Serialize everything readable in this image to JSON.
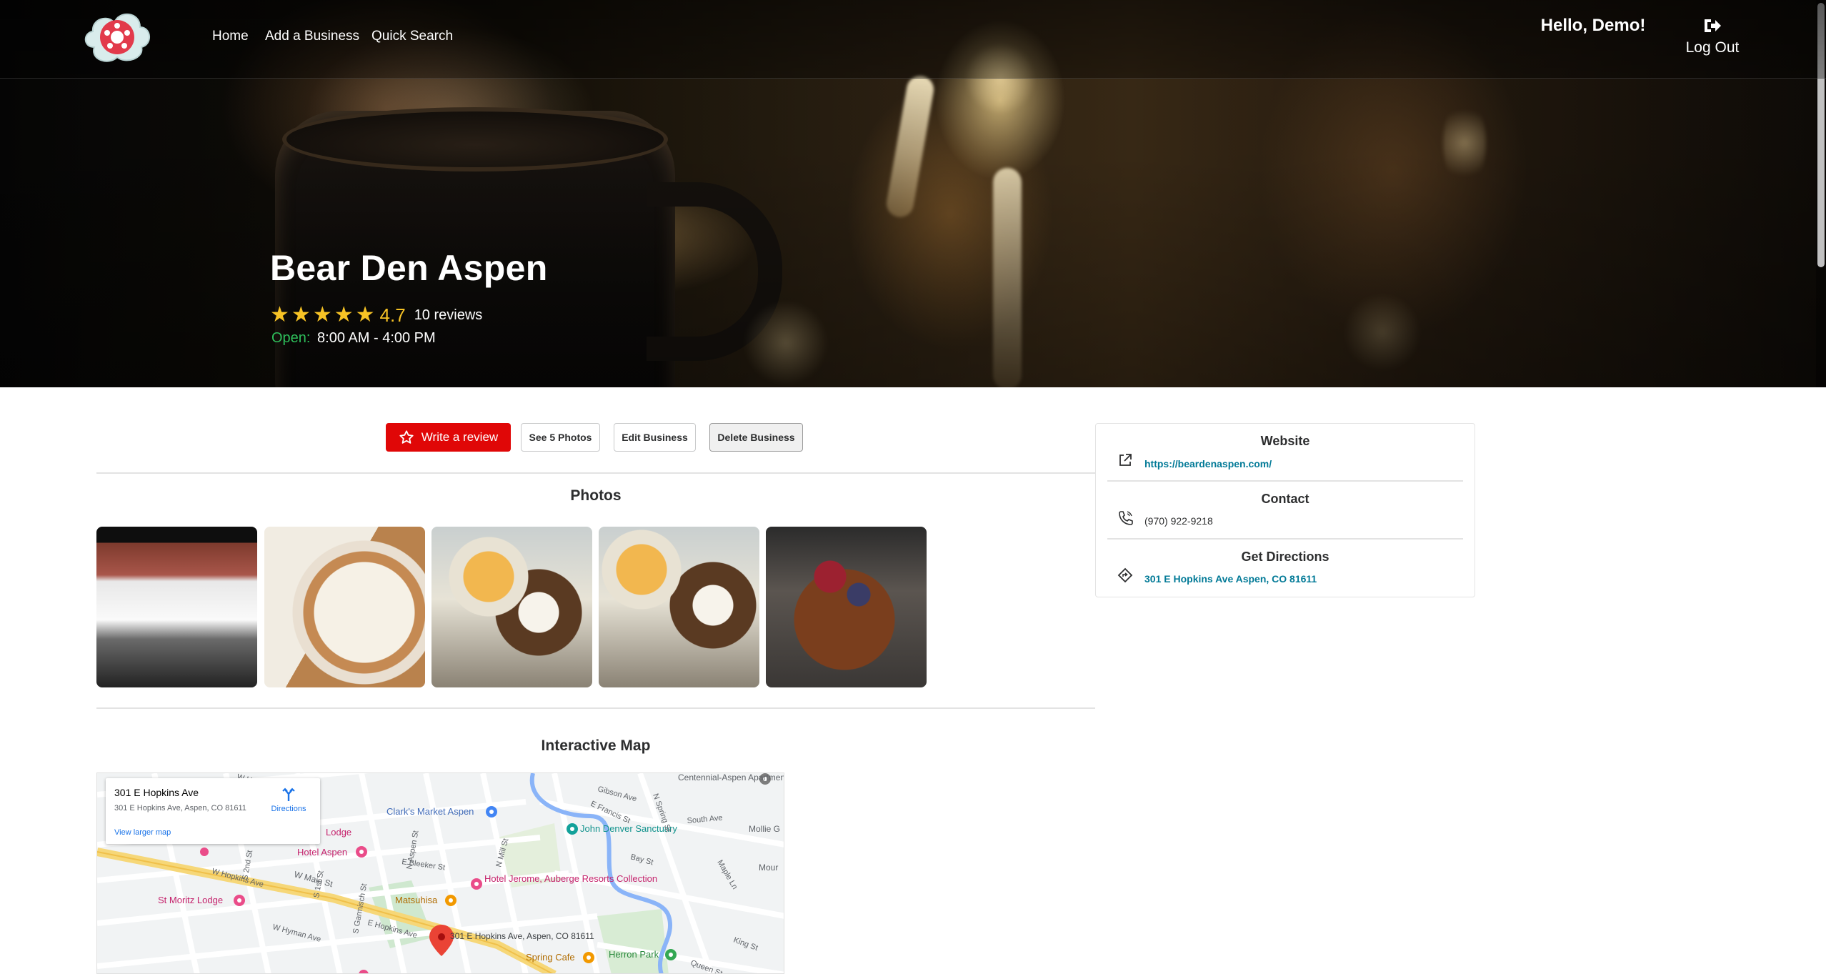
{
  "nav": {
    "links": [
      "Home",
      "Add a Business",
      "Quick Search"
    ],
    "greeting": "Hello, Demo!",
    "logout_label": "Log Out"
  },
  "business": {
    "name": "Bear Den Aspen",
    "rating": "4.7",
    "stars_filled": 5,
    "review_count": "10 reviews",
    "open_label": "Open:",
    "hours": "8:00 AM - 4:00 PM"
  },
  "actions": {
    "write_review": "Write a review",
    "see_photos": "See 5 Photos",
    "edit": "Edit Business",
    "delete": "Delete Business"
  },
  "photos": {
    "title": "Photos",
    "count": 5
  },
  "map": {
    "title": "Interactive Map",
    "card_title": "301 E Hopkins Ave",
    "card_address": "301 E Hopkins Ave, Aspen, CO 81611",
    "directions": "Directions",
    "larger_map": "View larger map",
    "pin_label": "301 E Hopkins Ave, Aspen, CO 81611",
    "labels": {
      "clarks": "Clark's Market Aspen",
      "john_denver": "John Denver Sanctuary",
      "hotel_aspen": "Hotel Aspen",
      "hotel_jerome": "Hotel Jerome, Auberge Resorts Collection",
      "st_moritz": "St Moritz Lodge",
      "matsuhisa": "Matsuhisa",
      "spring_cafe": "Spring Cafe",
      "herron_park": "Herron Park",
      "centennial": "Centennial-Aspen Apartments",
      "lodge": "Lodge",
      "mollie": "Mollie G",
      "mour": "Mour",
      "w_main": "W Main St",
      "w_hopkins": "W Hopkins Ave",
      "w_hyman": "W Hyman Ave",
      "e_hopkins": "E Hopkins Ave",
      "e_bleeker": "E Bleeker St",
      "n_mill": "N Mill St",
      "gibson": "Gibson Ave",
      "south_ave": "South Ave",
      "bay_st": "Bay St",
      "maple_ln": "Maple Ln",
      "king_st": "King St",
      "queen_st": "Queen St",
      "n_spring": "N Spring St",
      "n_aspen": "N Aspen St",
      "garmisch": "S Garmisch St",
      "first": "S 1st St",
      "second": "S 2nd St",
      "francis": "E Francis St",
      "w_hallam": "W Hallam"
    }
  },
  "sidebar": {
    "website_title": "Website",
    "website_url": "https://beardenaspen.com/",
    "contact_title": "Contact",
    "phone": "(970) 922-9218",
    "directions_title": "Get Directions",
    "address": "301 E Hopkins Ave Aspen, CO 81611"
  },
  "colors": {
    "brand_red": "#e00707",
    "star_yellow": "#f7c325",
    "open_green": "#2ebf5b",
    "link_teal": "#027a97"
  }
}
